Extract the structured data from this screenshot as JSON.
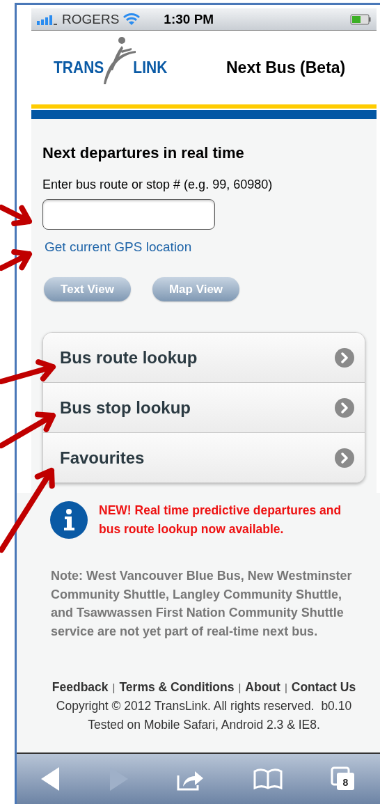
{
  "status_bar": {
    "carrier": "ROGERS",
    "time": "1:30 PM"
  },
  "header": {
    "logo_words": [
      "TRANS",
      "LINK"
    ],
    "title": "Next Bus (Beta)"
  },
  "search": {
    "heading": "Next departures in real time",
    "label": "Enter bus route or stop # (e.g. 99, 60980)",
    "gps_link": "Get current GPS location",
    "buttons": [
      "Text View",
      "Map View"
    ]
  },
  "menu": [
    {
      "label": "Bus route lookup"
    },
    {
      "label": "Bus stop lookup"
    },
    {
      "label": "Favourites"
    }
  ],
  "notice": "NEW! Real time predictive departures and bus route lookup now available.",
  "note": "Note: West Vancouver Blue Bus, New Westminster Community Shuttle, Langley Community Shuttle, and Tsawwassen First Nation Community Shuttle service are not yet part of real-time next bus.",
  "footer": {
    "links": [
      "Feedback",
      "Terms & Conditions",
      "About",
      "Contact Us"
    ],
    "separator": "|",
    "copyright": "Copyright © 2012 TransLink. All rights reserved.  b0.10",
    "tested": "Tested on Mobile Safari, Android 2.3 & IE8."
  },
  "toolbar": {
    "tabs_count": "8"
  }
}
